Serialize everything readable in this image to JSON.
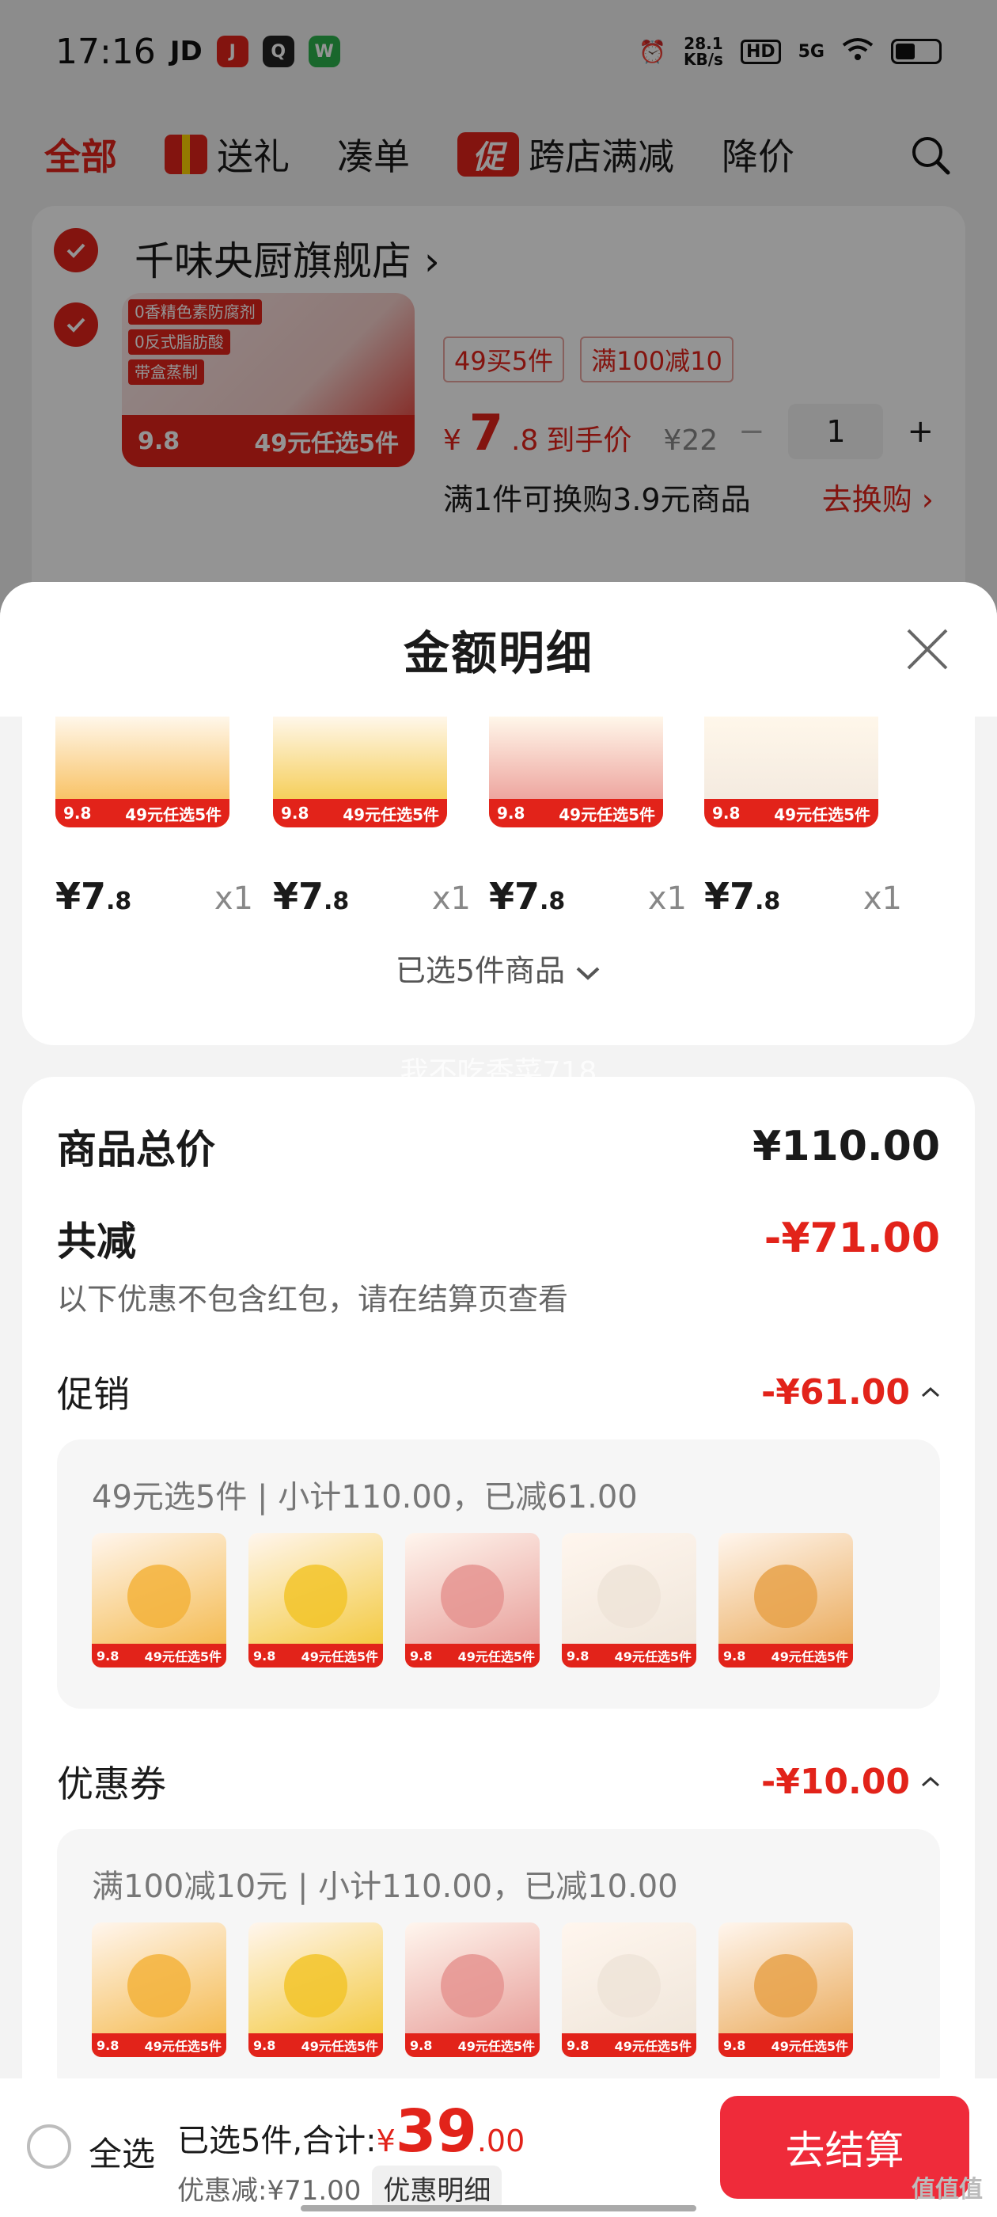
{
  "status_bar": {
    "time": "17:16",
    "carrier": "JD",
    "net_speed_value": "28.1",
    "net_speed_unit": "KB/s",
    "hd": "HD",
    "signal": "5G"
  },
  "tabs": [
    {
      "label": "全部",
      "active": true
    },
    {
      "label": "送礼",
      "icon": "gift-icon"
    },
    {
      "label": "凑单"
    },
    {
      "label": "跨店满减",
      "badge": "促"
    },
    {
      "label": "降价"
    }
  ],
  "store": {
    "name": "千味央厨旗舰店 ›",
    "tags": [
      "49买5件",
      "满100减10"
    ],
    "price_yen": "¥",
    "price_int": "7",
    "price_dec": ".8",
    "price_suffix": "到手价",
    "old_price": "¥22",
    "quantity": "1",
    "swap_text": "满1件可换购3.9元商品",
    "swap_link": "去换购 ›",
    "thumb_tags": [
      "0香精色素防腐剂",
      "0反式脂肪酸",
      "带盒蒸制"
    ],
    "thumb_price": "9.8",
    "thumb_offer": "49元任选5件"
  },
  "sheet": {
    "title": "金额明细",
    "items": [
      {
        "price_int": "¥7",
        "price_dec": ".8",
        "qty": "x1",
        "bar_price": "9.8",
        "bar_offer": "49元任选5件",
        "tint": "#f6b13a"
      },
      {
        "price_int": "¥7",
        "price_dec": ".8",
        "qty": "x1",
        "bar_price": "9.8",
        "bar_offer": "49元任选5件",
        "tint": "#f2c12a"
      },
      {
        "price_int": "¥7",
        "price_dec": ".8",
        "qty": "x1",
        "bar_price": "9.8",
        "bar_offer": "49元任选5件",
        "tint": "#e88a86"
      },
      {
        "price_int": "¥7",
        "price_dec": ".8",
        "qty": "x1",
        "bar_price": "9.8",
        "bar_offer": "49元任选5件",
        "tint": "#f0e6dc"
      }
    ],
    "selected_summary": "已选5件商品",
    "watermark": "我不吃香菜718",
    "total_label": "商品总价",
    "total_value": "¥110.00",
    "reduce_label": "共减",
    "reduce_value": "-¥71.00",
    "reduce_note": "以下优惠不包含红包，请在结算页查看",
    "promo_label": "促销",
    "promo_value": "-¥61.00",
    "promo_caption": "49元选5件 | 小计110.00，已减61.00",
    "coupon_label": "优惠券",
    "coupon_value": "-¥10.00",
    "coupon_caption": "满100减10元 | 小计110.00，已减10.00",
    "thumbs": [
      {
        "price": "9.8",
        "offer": "49元任选5件",
        "tint": "#f3b33c"
      },
      {
        "price": "9.8",
        "offer": "49元任选5件",
        "tint": "#f2c42a"
      },
      {
        "price": "9.8",
        "offer": "49元任选5件",
        "tint": "#e59490"
      },
      {
        "price": "9.8",
        "offer": "49元任选5件",
        "tint": "#eee4d8"
      },
      {
        "price": "9.8",
        "offer": "49元任选5件",
        "tint": "#e8a24a"
      }
    ]
  },
  "checkout": {
    "select_all": "全选",
    "summary_prefix": "已选5件,合计:",
    "total_yen": "¥",
    "total_int": "39",
    "total_dec": ".00",
    "discount_text": "优惠减:¥71.00",
    "discount_button": "优惠明细",
    "button": "去结算",
    "corner_mark": "值值值"
  },
  "colors": {
    "accent": "#e2231a",
    "checkout_button": "#ef2b3a"
  }
}
